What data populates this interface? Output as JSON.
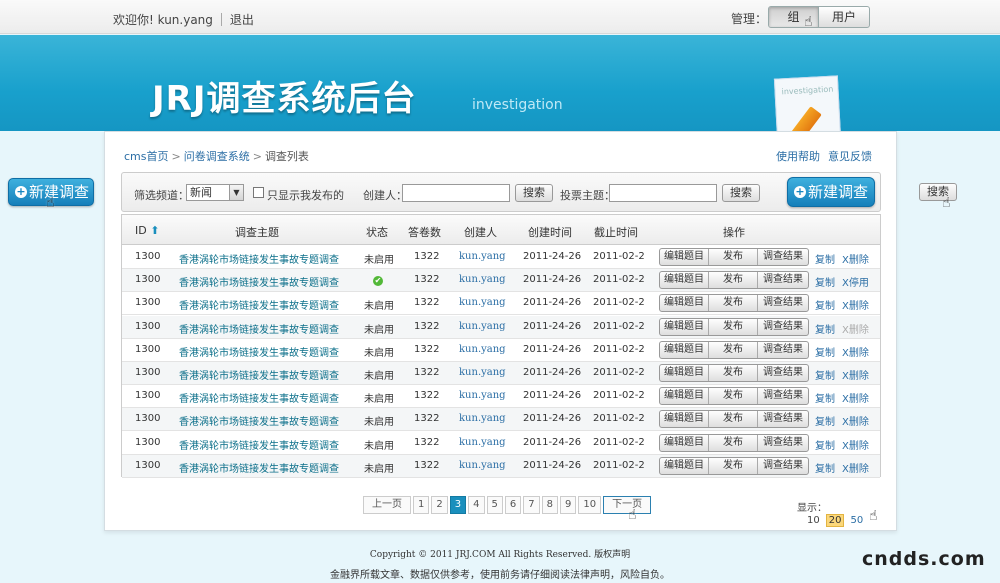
{
  "topbar": {
    "welcome": "欢迎你! kun.yang",
    "logout": "退出",
    "management_label": "管理：",
    "tabs": [
      "组",
      "用户"
    ]
  },
  "banner": {
    "title": "JRJ调查系统后台",
    "subtitle": "investigation",
    "art_text": "investigation"
  },
  "side": {
    "new_survey": "新建调查",
    "search": "搜索"
  },
  "breadcrumb": [
    "cms首页",
    "问卷调查系统",
    "调查列表"
  ],
  "toplinks": [
    "使用帮助",
    "意见反馈"
  ],
  "filter": {
    "channel_label": "筛选频道：",
    "channel_value": "新闻",
    "only_mine_label": "只显示我发布的",
    "creator_label": "创建人：",
    "creator_value": "",
    "subject_label": "投票主题：",
    "subject_value": "",
    "search_button": "搜索",
    "new_survey": "新建调查"
  },
  "table": {
    "headers": {
      "id": "ID",
      "subject": "调查主题",
      "status": "状态",
      "answers": "答卷数",
      "creator": "创建人",
      "created": "创建时间",
      "deadline": "截止时间",
      "ops": "操作"
    },
    "op_labels": [
      "编辑题目",
      "发布",
      "调查结果"
    ],
    "copy_label": "复制",
    "rows": [
      {
        "id": "1300",
        "subject": "香港涡轮市场链接发生事故专题调查",
        "status": "未启用",
        "answers": "1322",
        "creator": "kun.yang",
        "created": "2011-24-26",
        "deadline": "2011-02-2",
        "action": "X删除",
        "action_disabled": false
      },
      {
        "id": "1300",
        "subject": "香港涡轮市场链接发生事故专题调查",
        "status": "✔",
        "answers": "1322",
        "creator": "kun.yang",
        "created": "2011-24-26",
        "deadline": "2011-02-2",
        "action": "X停用",
        "action_disabled": false
      },
      {
        "id": "1300",
        "subject": "香港涡轮市场链接发生事故专题调查",
        "status": "未启用",
        "answers": "1322",
        "creator": "kun.yang",
        "created": "2011-24-26",
        "deadline": "2011-02-2",
        "action": "X删除",
        "action_disabled": false
      },
      {
        "id": "1300",
        "subject": "香港涡轮市场链接发生事故专题调查",
        "status": "未启用",
        "answers": "1322",
        "creator": "kun.yang",
        "created": "2011-24-26",
        "deadline": "2011-02-2",
        "action": "X删除",
        "action_disabled": true
      },
      {
        "id": "1300",
        "subject": "香港涡轮市场链接发生事故专题调查",
        "status": "未启用",
        "answers": "1322",
        "creator": "kun.yang",
        "created": "2011-24-26",
        "deadline": "2011-02-2",
        "action": "X删除",
        "action_disabled": false
      },
      {
        "id": "1300",
        "subject": "香港涡轮市场链接发生事故专题调查",
        "status": "未启用",
        "answers": "1322",
        "creator": "kun.yang",
        "created": "2011-24-26",
        "deadline": "2011-02-2",
        "action": "X删除",
        "action_disabled": false
      },
      {
        "id": "1300",
        "subject": "香港涡轮市场链接发生事故专题调查",
        "status": "未启用",
        "answers": "1322",
        "creator": "kun.yang",
        "created": "2011-24-26",
        "deadline": "2011-02-2",
        "action": "X删除",
        "action_disabled": false
      },
      {
        "id": "1300",
        "subject": "香港涡轮市场链接发生事故专题调查",
        "status": "未启用",
        "answers": "1322",
        "creator": "kun.yang",
        "created": "2011-24-26",
        "deadline": "2011-02-2",
        "action": "X删除",
        "action_disabled": false
      },
      {
        "id": "1300",
        "subject": "香港涡轮市场链接发生事故专题调查",
        "status": "未启用",
        "answers": "1322",
        "creator": "kun.yang",
        "created": "2011-24-26",
        "deadline": "2011-02-2",
        "action": "X删除",
        "action_disabled": false
      },
      {
        "id": "1300",
        "subject": "香港涡轮市场链接发生事故专题调查",
        "status": "未启用",
        "answers": "1322",
        "creator": "kun.yang",
        "created": "2011-24-26",
        "deadline": "2011-02-2",
        "action": "X删除",
        "action_disabled": false
      }
    ]
  },
  "pager": {
    "prev": "上一页",
    "pages": [
      "1",
      "2",
      "3",
      "4",
      "5",
      "6",
      "7",
      "8",
      "9",
      "10"
    ],
    "current": "3",
    "next": "下一页"
  },
  "page_size": {
    "label": "显示：",
    "options": [
      "10",
      "20",
      "50"
    ],
    "selected": "20"
  },
  "footer": {
    "copyright": "Copyright © 2011 JRJ.COM All Rights Reserved.   版权声明",
    "disclaimer": "金融界所载文章、数据仅供参考，使用前务请仔细阅读法律声明，风险自负。",
    "brand": "cndds.com"
  },
  "colors": {
    "banner": "#18a0cc",
    "accent_button": "#157fba",
    "link": "#2b6ea5",
    "subject_link": "#0b6f8a",
    "page_current": "#1a8fbd",
    "page_size_selected": "#fbd77a"
  }
}
